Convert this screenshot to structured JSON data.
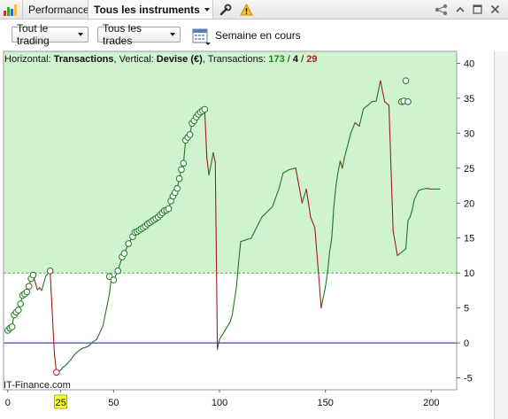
{
  "tabs": {
    "performance_label": "Performance",
    "instruments_label": "Tous les instruments"
  },
  "toolbar": {
    "trading_filter": "Tout le trading",
    "trades_filter": "Tous les trades",
    "period_label": "Semaine en cours"
  },
  "chart_info": {
    "horizontal_prefix": "Horizontal: ",
    "horizontal_value": "Transactions",
    "vertical_prefix": ", Vertical: ",
    "vertical_value": "Devise (€)",
    "transactions_prefix": ", Transactions: ",
    "count_win": "173",
    "sep1": " / ",
    "count_neutral": "4",
    "sep2": " / ",
    "count_loss": "29"
  },
  "brand": "IT-Finance.com",
  "colors": {
    "profit_zone": "#cff2cf",
    "up_line": "#1f7a1f",
    "down_line": "#a41a1a",
    "zero_line": "#1a1aa8",
    "marker_highlight": "#ffff33"
  },
  "chart_data": {
    "type": "line",
    "xlim": [
      -2,
      212
    ],
    "ylim": [
      -6.7,
      41.7
    ],
    "x_ticks": [
      0,
      50,
      100,
      150,
      200
    ],
    "y_ticks": [
      -5,
      0,
      5,
      10,
      15,
      20,
      25,
      30,
      35,
      40
    ],
    "x_tick_labels": [
      "0",
      "25",
      "50",
      "100",
      "150",
      "200"
    ],
    "y_tick_labels": [
      "-5",
      "0",
      "5",
      "10",
      "15",
      "20",
      "25",
      "30",
      "35",
      "40"
    ],
    "highlight_x": 25,
    "highlight_label": "25",
    "shaded_above": 10,
    "zero_line": 0,
    "x": [
      0,
      1,
      2,
      3,
      4,
      5,
      6,
      7,
      8,
      9,
      10,
      11,
      12,
      14,
      15,
      16,
      18,
      20,
      22,
      23,
      25,
      26,
      27,
      28,
      30,
      32,
      35,
      38,
      40,
      42,
      45,
      48,
      49,
      50,
      52,
      54,
      55,
      57,
      59,
      60,
      61,
      62,
      63,
      64,
      65,
      66,
      67,
      68,
      69,
      70,
      71,
      72,
      73,
      74,
      75,
      76,
      77,
      78,
      79,
      80,
      81,
      82,
      83,
      84,
      85,
      86,
      87,
      88,
      89,
      90,
      91,
      92,
      93,
      94,
      95,
      96,
      97,
      98,
      99,
      100,
      101,
      103,
      105,
      106,
      108,
      109,
      110,
      115,
      120,
      125,
      128,
      130,
      133,
      136,
      139,
      141,
      143,
      145,
      147,
      148,
      150,
      151,
      152,
      153,
      154,
      155,
      156,
      157,
      158,
      159,
      162,
      164,
      166,
      168,
      170,
      172,
      174,
      176,
      178,
      180,
      182,
      184,
      186,
      187,
      188,
      189,
      190,
      191,
      192,
      194,
      196,
      198,
      200,
      202,
      204
    ],
    "values": [
      1.8,
      2.1,
      2.3,
      4.0,
      4.4,
      4.7,
      5.6,
      6.8,
      7.0,
      7.3,
      8.1,
      9.2,
      9.7,
      7.6,
      7.9,
      7.5,
      9.6,
      10.3,
      -1.5,
      -4.2,
      -3.9,
      -3.5,
      -3.3,
      -3.0,
      -2.3,
      -1.5,
      -0.8,
      -0.5,
      0.1,
      0.5,
      2.5,
      7.0,
      9.5,
      9.0,
      10.3,
      12.3,
      12.8,
      14.2,
      15.2,
      15.8,
      15.9,
      16.1,
      16.3,
      16.5,
      16.7,
      17.0,
      17.2,
      17.4,
      17.6,
      17.8,
      18.0,
      18.3,
      18.6,
      18.9,
      19.0,
      19.2,
      20.3,
      21.0,
      21.5,
      22.1,
      23.5,
      24.8,
      25.7,
      29.0,
      29.4,
      29.8,
      31.4,
      31.8,
      32.3,
      32.7,
      33.0,
      33.2,
      33.4,
      26.5,
      24.0,
      25.5,
      27.2,
      25.8,
      -0.9,
      0.5,
      1.0,
      2.0,
      3.0,
      4.0,
      8.0,
      11.5,
      14.5,
      15.0,
      18.0,
      19.5,
      22.0,
      24.3,
      24.8,
      25.0,
      20.0,
      22.0,
      18.0,
      16.5,
      9.0,
      5.0,
      8.0,
      10.0,
      13.0,
      15.0,
      19.5,
      22.5,
      24.5,
      26.0,
      25.0,
      26.5,
      30.0,
      31.5,
      31.0,
      33.5,
      34.0,
      34.5,
      34.6,
      37.5,
      34.5,
      34.0,
      16.0,
      12.5,
      13.0,
      13.2,
      13.5,
      17.5,
      18.0,
      19.0,
      20.5,
      21.8,
      22.0,
      22.1,
      22.0,
      22.0,
      22.0
    ],
    "circles": [
      [
        0,
        1.8
      ],
      [
        1,
        2.1
      ],
      [
        2,
        2.3
      ],
      [
        3,
        4.0
      ],
      [
        4,
        4.4
      ],
      [
        5,
        4.7
      ],
      [
        6,
        5.6
      ],
      [
        7,
        6.8
      ],
      [
        8,
        7.0
      ],
      [
        9,
        7.3
      ],
      [
        10,
        8.1
      ],
      [
        11,
        9.2
      ],
      [
        12,
        9.7
      ],
      [
        20,
        10.3
      ],
      [
        23,
        -4.2
      ],
      [
        48,
        9.5
      ],
      [
        50,
        9.0
      ],
      [
        52,
        10.3
      ],
      [
        54,
        12.3
      ],
      [
        55,
        12.8
      ],
      [
        57,
        14.2
      ],
      [
        59,
        15.2
      ],
      [
        60,
        15.8
      ],
      [
        61,
        15.9
      ],
      [
        62,
        16.1
      ],
      [
        63,
        16.3
      ],
      [
        64,
        16.5
      ],
      [
        65,
        16.7
      ],
      [
        66,
        17.0
      ],
      [
        67,
        17.2
      ],
      [
        68,
        17.4
      ],
      [
        69,
        17.6
      ],
      [
        70,
        17.8
      ],
      [
        71,
        18.0
      ],
      [
        72,
        18.3
      ],
      [
        73,
        18.6
      ],
      [
        74,
        18.9
      ],
      [
        75,
        19.0
      ],
      [
        76,
        19.2
      ],
      [
        77,
        20.3
      ],
      [
        78,
        21.0
      ],
      [
        79,
        21.5
      ],
      [
        80,
        22.1
      ],
      [
        81,
        23.5
      ],
      [
        82,
        24.8
      ],
      [
        83,
        25.7
      ],
      [
        84,
        29.0
      ],
      [
        85,
        29.4
      ],
      [
        86,
        29.8
      ],
      [
        87,
        31.4
      ],
      [
        88,
        31.8
      ],
      [
        89,
        32.3
      ],
      [
        90,
        32.7
      ],
      [
        91,
        33.0
      ],
      [
        92,
        33.2
      ],
      [
        93,
        33.4
      ],
      [
        186,
        34.5
      ],
      [
        187,
        34.6
      ],
      [
        188,
        37.5
      ],
      [
        189,
        34.5
      ]
    ]
  }
}
